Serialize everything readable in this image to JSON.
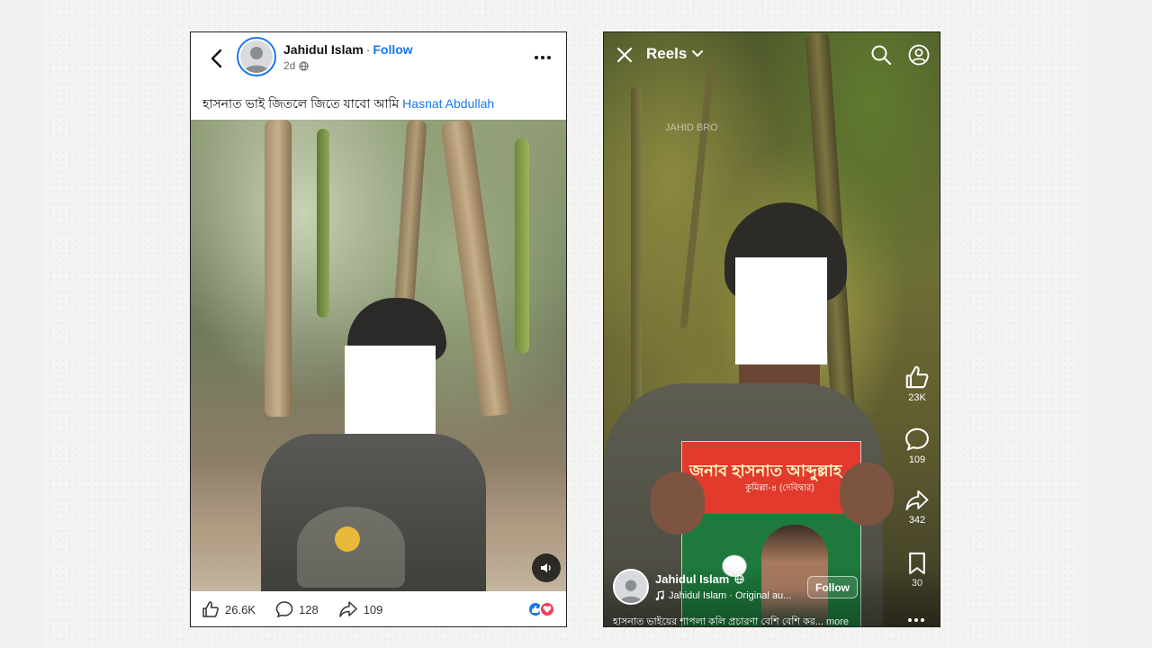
{
  "post": {
    "author": "Jahidul Islam",
    "separator": "·",
    "follow_label": "Follow",
    "time": "2d",
    "caption_text": "হাসনাত ভাই জিতলে জিতে যাবো আমি",
    "caption_mention": "Hasnat Abdullah",
    "likes": "26.6K",
    "comments": "128",
    "shares": "109"
  },
  "reel": {
    "title": "Reels",
    "watermark": "JAHID BRO",
    "poster_line1": "জনাব হাসনাত আব্দুল্লাহ",
    "poster_line2": "কুমিল্লা-৪ (দেবিদ্বার)",
    "likes": "23K",
    "comments": "109",
    "shares": "342",
    "saves": "30",
    "author": "Jahidul Islam",
    "audio": "Jahidul Islam · Original au...",
    "follow_label": "Follow",
    "caption": "হাসনাত ভাইয়ের শাপলা কলি প্রচারণা বেশি বেশি কর...",
    "more_label": "more"
  },
  "colors": {
    "facebook_blue": "#1877f2",
    "love_red": "#f33e58"
  }
}
